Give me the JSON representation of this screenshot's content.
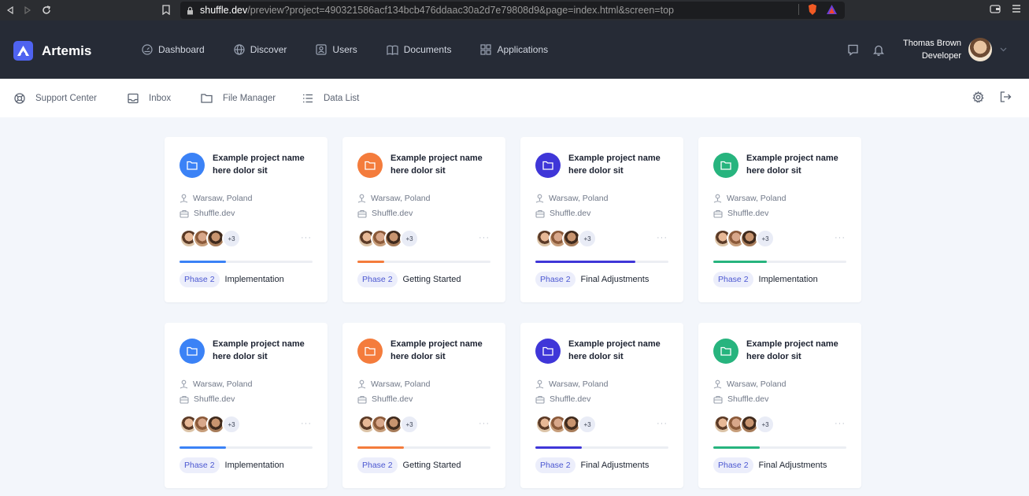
{
  "browser": {
    "url_domain": "shuffle.dev",
    "url_path": "/preview?project=490321586acf134bcb476ddaac30a2d7e79808d9&page=index.html&screen=top"
  },
  "app": {
    "brand": "Artemis",
    "nav": [
      {
        "label": "Dashboard",
        "icon": "dashboard-icon"
      },
      {
        "label": "Discover",
        "icon": "globe-icon"
      },
      {
        "label": "Users",
        "icon": "user-icon"
      },
      {
        "label": "Documents",
        "icon": "book-icon"
      },
      {
        "label": "Applications",
        "icon": "grid-icon"
      }
    ],
    "user": {
      "name": "Thomas Brown",
      "role": "Developer"
    }
  },
  "subnav": [
    {
      "label": "Support Center",
      "icon": "lifebuoy-icon"
    },
    {
      "label": "Inbox",
      "icon": "inbox-icon"
    },
    {
      "label": "File Manager",
      "icon": "folder-icon"
    },
    {
      "label": "Data List",
      "icon": "list-icon"
    }
  ],
  "cards": [
    {
      "title": "Example project name here dolor sit",
      "location": "Warsaw, Poland",
      "company": "Shuffle.dev",
      "more": "+3",
      "progress": 0.35,
      "color": "#3b82f6",
      "phase": "Phase 2",
      "stage": "Implementation"
    },
    {
      "title": "Example project name here dolor sit",
      "location": "Warsaw, Poland",
      "company": "Shuffle.dev",
      "more": "+3",
      "progress": 0.2,
      "color": "#f47c3c",
      "phase": "Phase 2",
      "stage": "Getting Started"
    },
    {
      "title": "Example project name here dolor sit",
      "location": "Warsaw, Poland",
      "company": "Shuffle.dev",
      "more": "+3",
      "progress": 0.75,
      "color": "#3f36d8",
      "phase": "Phase 2",
      "stage": "Final Adjustments"
    },
    {
      "title": "Example project name here dolor sit",
      "location": "Warsaw, Poland",
      "company": "Shuffle.dev",
      "more": "+3",
      "progress": 0.4,
      "color": "#27b47e",
      "phase": "Phase 2",
      "stage": "Implementation"
    },
    {
      "title": "Example project name here dolor sit",
      "location": "Warsaw, Poland",
      "company": "Shuffle.dev",
      "more": "+3",
      "progress": 0.35,
      "color": "#3b82f6",
      "phase": "Phase 2",
      "stage": "Implementation"
    },
    {
      "title": "Example project name here dolor sit",
      "location": "Warsaw, Poland",
      "company": "Shuffle.dev",
      "more": "+3",
      "progress": 0.35,
      "color": "#f47c3c",
      "phase": "Phase 2",
      "stage": "Getting Started"
    },
    {
      "title": "Example project name here dolor sit",
      "location": "Warsaw, Poland",
      "company": "Shuffle.dev",
      "more": "+3",
      "progress": 0.35,
      "color": "#3f36d8",
      "phase": "Phase 2",
      "stage": "Final Adjustments"
    },
    {
      "title": "Example project name here dolor sit",
      "location": "Warsaw, Poland",
      "company": "Shuffle.dev",
      "more": "+3",
      "progress": 0.35,
      "color": "#27b47e",
      "phase": "Phase 2",
      "stage": "Final Adjustments"
    }
  ]
}
